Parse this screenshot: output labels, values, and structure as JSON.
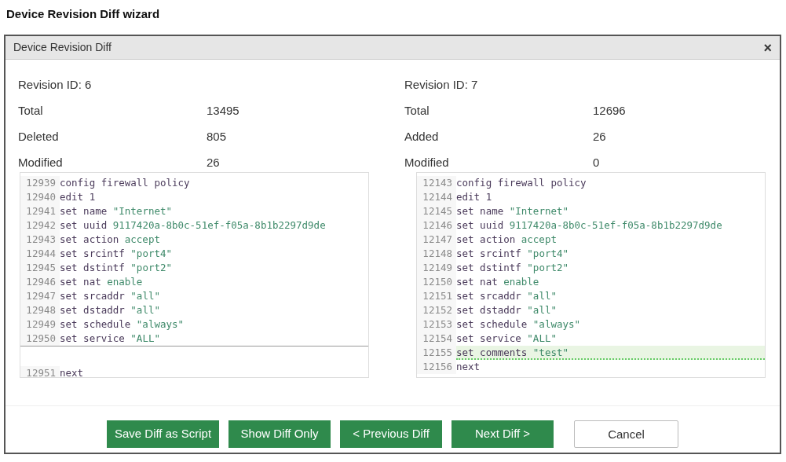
{
  "page_title": "Device Revision Diff wizard",
  "dialog": {
    "title": "Device Revision Diff",
    "close": "×"
  },
  "revisions": [
    {
      "id_label": "Revision ID: 6",
      "stats": [
        {
          "label": "Total",
          "value": "13495"
        },
        {
          "label": "Deleted",
          "value": "805"
        },
        {
          "label": "Modified",
          "value": "26"
        }
      ]
    },
    {
      "id_label": "Revision ID: 7",
      "stats": [
        {
          "label": "Total",
          "value": "12696"
        },
        {
          "label": "Added",
          "value": "26"
        },
        {
          "label": "Modified",
          "value": "0"
        }
      ]
    }
  ],
  "panes": [
    {
      "lines": [
        {
          "kind": "normal",
          "number": "12939",
          "cmd": "config firewall policy"
        },
        {
          "kind": "normal",
          "number": "12940",
          "cmd": "edit 1"
        },
        {
          "kind": "normal",
          "number": "12941",
          "cmd": "set name",
          "arg": "\"Internet\""
        },
        {
          "kind": "normal",
          "number": "12942",
          "cmd": "set uuid",
          "arg": "9117420a-8b0c-51ef-f05a-8b1b2297d9de"
        },
        {
          "kind": "normal",
          "number": "12943",
          "cmd": "set action",
          "arg": "accept"
        },
        {
          "kind": "normal",
          "number": "12944",
          "cmd": "set srcintf",
          "arg": "\"port4\""
        },
        {
          "kind": "normal",
          "number": "12945",
          "cmd": "set dstintf",
          "arg": "\"port2\""
        },
        {
          "kind": "normal",
          "number": "12946",
          "cmd": "set nat",
          "arg": "enable"
        },
        {
          "kind": "normal",
          "number": "12947",
          "cmd": "set srcaddr",
          "arg": "\"all\""
        },
        {
          "kind": "normal",
          "number": "12948",
          "cmd": "set dstaddr",
          "arg": "\"all\""
        },
        {
          "kind": "normal",
          "number": "12949",
          "cmd": "set schedule",
          "arg": "\"always\""
        },
        {
          "kind": "normal",
          "number": "12950",
          "cmd": "set service",
          "arg": "\"ALL\""
        },
        {
          "kind": "gap"
        },
        {
          "kind": "normal",
          "number": "12951",
          "cmd": "next"
        }
      ]
    },
    {
      "lines": [
        {
          "kind": "normal",
          "number": "12143",
          "cmd": "config firewall policy"
        },
        {
          "kind": "normal",
          "number": "12144",
          "cmd": "edit 1"
        },
        {
          "kind": "normal",
          "number": "12145",
          "cmd": "set name",
          "arg": "\"Internet\""
        },
        {
          "kind": "normal",
          "number": "12146",
          "cmd": "set uuid",
          "arg": "9117420a-8b0c-51ef-f05a-8b1b2297d9de"
        },
        {
          "kind": "normal",
          "number": "12147",
          "cmd": "set action",
          "arg": "accept"
        },
        {
          "kind": "normal",
          "number": "12148",
          "cmd": "set srcintf",
          "arg": "\"port4\""
        },
        {
          "kind": "normal",
          "number": "12149",
          "cmd": "set dstintf",
          "arg": "\"port2\""
        },
        {
          "kind": "normal",
          "number": "12150",
          "cmd": "set nat",
          "arg": "enable"
        },
        {
          "kind": "normal",
          "number": "12151",
          "cmd": "set srcaddr",
          "arg": "\"all\""
        },
        {
          "kind": "normal",
          "number": "12152",
          "cmd": "set dstaddr",
          "arg": "\"all\""
        },
        {
          "kind": "normal",
          "number": "12153",
          "cmd": "set schedule",
          "arg": "\"always\""
        },
        {
          "kind": "normal",
          "number": "12154",
          "cmd": "set service",
          "arg": "\"ALL\""
        },
        {
          "kind": "added",
          "number": "12155",
          "cmd": "set comments",
          "arg": "\"test\""
        },
        {
          "kind": "normal",
          "number": "12156",
          "cmd": "next"
        }
      ]
    }
  ],
  "buttons": [
    {
      "label": "Save Diff as Script",
      "kind": "primary"
    },
    {
      "label": "Show Diff Only",
      "kind": "primary"
    },
    {
      "label": "< Previous Diff",
      "kind": "primary"
    },
    {
      "label": "Next Diff >",
      "kind": "primary"
    },
    {
      "label": "Cancel",
      "kind": "secondary"
    }
  ]
}
